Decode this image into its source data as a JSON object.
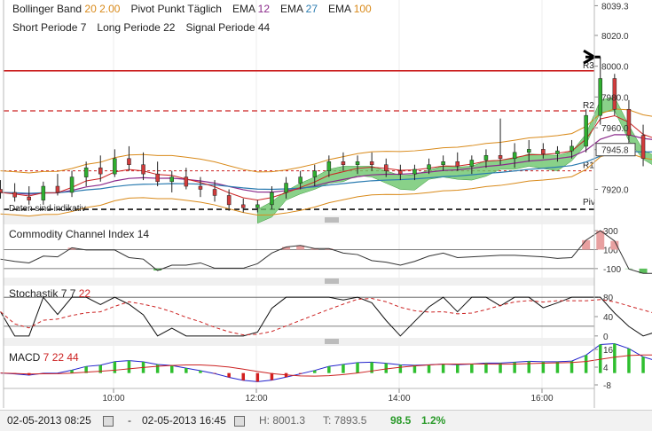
{
  "header": {
    "row1": [
      {
        "text": "Bollinger Band",
        "color": "#222222"
      },
      {
        "text": "20",
        "color": "#d98a1a"
      },
      {
        "text": "2.00",
        "color": "#d98a1a"
      },
      {
        "text": "Pivot Punkt",
        "color": "#222222"
      },
      {
        "text": "Täglich",
        "color": "#222222"
      },
      {
        "text": "EMA",
        "color": "#222222"
      },
      {
        "text": "12",
        "color": "#8b2a8b"
      },
      {
        "text": "EMA",
        "color": "#222222"
      },
      {
        "text": "27",
        "color": "#2a7bb0"
      },
      {
        "text": "EMA",
        "color": "#222222"
      },
      {
        "text": "100",
        "color": "#d98a1a"
      }
    ],
    "row2": [
      {
        "text": "Short Periode",
        "color": "#222222"
      },
      {
        "text": "7",
        "color": "#222222"
      },
      {
        "text": "Long Periode",
        "color": "#222222"
      },
      {
        "text": "22",
        "color": "#222222"
      },
      {
        "text": "Signal Periode",
        "color": "#222222"
      },
      {
        "text": "44",
        "color": "#222222"
      }
    ]
  },
  "chart_data": {
    "type": "candlestick",
    "x_ticks": [
      "10:00",
      "12:00",
      "14:00",
      "16:00"
    ],
    "price_ticks": [
      "8039.3",
      "8020.0",
      "8000.0",
      "7980.0",
      "7960.0",
      "7945.8",
      "7920.0"
    ],
    "current_price": 7945.8,
    "pivot_labels": [
      {
        "name": "R3",
        "value": 7997
      },
      {
        "name": "R2",
        "value": 7971
      },
      {
        "name": "R1",
        "value": 7932
      },
      {
        "name": "Piv",
        "value": 7907
      }
    ],
    "note": "Daten sind indikativ",
    "ylim": [
      7903,
      8043
    ],
    "candles": [
      {
        "o": 7920,
        "h": 7926,
        "l": 7914,
        "c": 7918
      },
      {
        "o": 7918,
        "h": 7924,
        "l": 7912,
        "c": 7915
      },
      {
        "o": 7915,
        "h": 7922,
        "l": 7910,
        "c": 7913
      },
      {
        "o": 7913,
        "h": 7925,
        "l": 7910,
        "c": 7922
      },
      {
        "o": 7922,
        "h": 7930,
        "l": 7916,
        "c": 7918
      },
      {
        "o": 7918,
        "h": 7932,
        "l": 7915,
        "c": 7928
      },
      {
        "o": 7928,
        "h": 7938,
        "l": 7922,
        "c": 7934
      },
      {
        "o": 7934,
        "h": 7942,
        "l": 7925,
        "c": 7930
      },
      {
        "o": 7930,
        "h": 7946,
        "l": 7928,
        "c": 7940
      },
      {
        "o": 7940,
        "h": 7948,
        "l": 7932,
        "c": 7936
      },
      {
        "o": 7936,
        "h": 7944,
        "l": 7926,
        "c": 7930
      },
      {
        "o": 7930,
        "h": 7938,
        "l": 7922,
        "c": 7925
      },
      {
        "o": 7925,
        "h": 7932,
        "l": 7918,
        "c": 7928
      },
      {
        "o": 7928,
        "h": 7934,
        "l": 7920,
        "c": 7922
      },
      {
        "o": 7922,
        "h": 7928,
        "l": 7915,
        "c": 7920
      },
      {
        "o": 7920,
        "h": 7926,
        "l": 7912,
        "c": 7916
      },
      {
        "o": 7916,
        "h": 7920,
        "l": 7906,
        "c": 7910
      },
      {
        "o": 7910,
        "h": 7914,
        "l": 7905,
        "c": 7908
      },
      {
        "o": 7908,
        "h": 7913,
        "l": 7905,
        "c": 7910
      },
      {
        "o": 7910,
        "h": 7922,
        "l": 7907,
        "c": 7918
      },
      {
        "o": 7918,
        "h": 7928,
        "l": 7914,
        "c": 7924
      },
      {
        "o": 7924,
        "h": 7932,
        "l": 7920,
        "c": 7928
      },
      {
        "o": 7928,
        "h": 7936,
        "l": 7922,
        "c": 7932
      },
      {
        "o": 7932,
        "h": 7942,
        "l": 7928,
        "c": 7938
      },
      {
        "o": 7938,
        "h": 7944,
        "l": 7932,
        "c": 7936
      },
      {
        "o": 7936,
        "h": 7942,
        "l": 7930,
        "c": 7938
      },
      {
        "o": 7938,
        "h": 7944,
        "l": 7932,
        "c": 7936
      },
      {
        "o": 7936,
        "h": 7940,
        "l": 7928,
        "c": 7932
      },
      {
        "o": 7932,
        "h": 7936,
        "l": 7926,
        "c": 7930
      },
      {
        "o": 7930,
        "h": 7936,
        "l": 7926,
        "c": 7933
      },
      {
        "o": 7933,
        "h": 7940,
        "l": 7930,
        "c": 7936
      },
      {
        "o": 7936,
        "h": 7942,
        "l": 7932,
        "c": 7938
      },
      {
        "o": 7938,
        "h": 7944,
        "l": 7932,
        "c": 7935
      },
      {
        "o": 7935,
        "h": 7942,
        "l": 7930,
        "c": 7939
      },
      {
        "o": 7939,
        "h": 7946,
        "l": 7934,
        "c": 7942
      },
      {
        "o": 7942,
        "h": 7966,
        "l": 7936,
        "c": 7940
      },
      {
        "o": 7940,
        "h": 7950,
        "l": 7934,
        "c": 7944
      },
      {
        "o": 7944,
        "h": 7952,
        "l": 7938,
        "c": 7946
      },
      {
        "o": 7946,
        "h": 7950,
        "l": 7940,
        "c": 7943
      },
      {
        "o": 7943,
        "h": 7948,
        "l": 7938,
        "c": 7945
      },
      {
        "o": 7945,
        "h": 7952,
        "l": 7940,
        "c": 7948
      },
      {
        "o": 7948,
        "h": 7972,
        "l": 7944,
        "c": 7968
      },
      {
        "o": 7968,
        "h": 8006,
        "l": 7962,
        "c": 7992
      },
      {
        "o": 7992,
        "h": 7995,
        "l": 7968,
        "c": 7972
      },
      {
        "o": 7972,
        "h": 7978,
        "l": 7950,
        "c": 7955
      },
      {
        "o": 7955,
        "h": 7962,
        "l": 7935,
        "c": 7940
      },
      {
        "o": 7940,
        "h": 7952,
        "l": 7936,
        "c": 7946
      }
    ]
  },
  "cci": {
    "label": "Commodity Channel Index",
    "param": "14",
    "ticks": [
      "300",
      "100",
      "-100"
    ]
  },
  "stoch": {
    "label": "Stochastik",
    "params": [
      {
        "text": "7",
        "color": "#222222"
      },
      {
        "text": "7",
        "color": "#222222"
      },
      {
        "text": "22",
        "color": "#cc2222"
      }
    ],
    "ticks": [
      "80",
      "40",
      "0"
    ]
  },
  "macd": {
    "label": "MACD",
    "params": [
      {
        "text": "7",
        "color": "#cc2222"
      },
      {
        "text": "22",
        "color": "#cc2222"
      },
      {
        "text": "44",
        "color": "#cc2222"
      }
    ],
    "ticks": [
      "16",
      "4",
      "-8"
    ]
  },
  "footer": {
    "start": "02-05-2013 08:25",
    "dash": "-",
    "end": "02-05-2013 16:45",
    "high": "H: 8001.3",
    "low": "T: 7893.5",
    "change": "98.5",
    "pct": "1.2%"
  }
}
